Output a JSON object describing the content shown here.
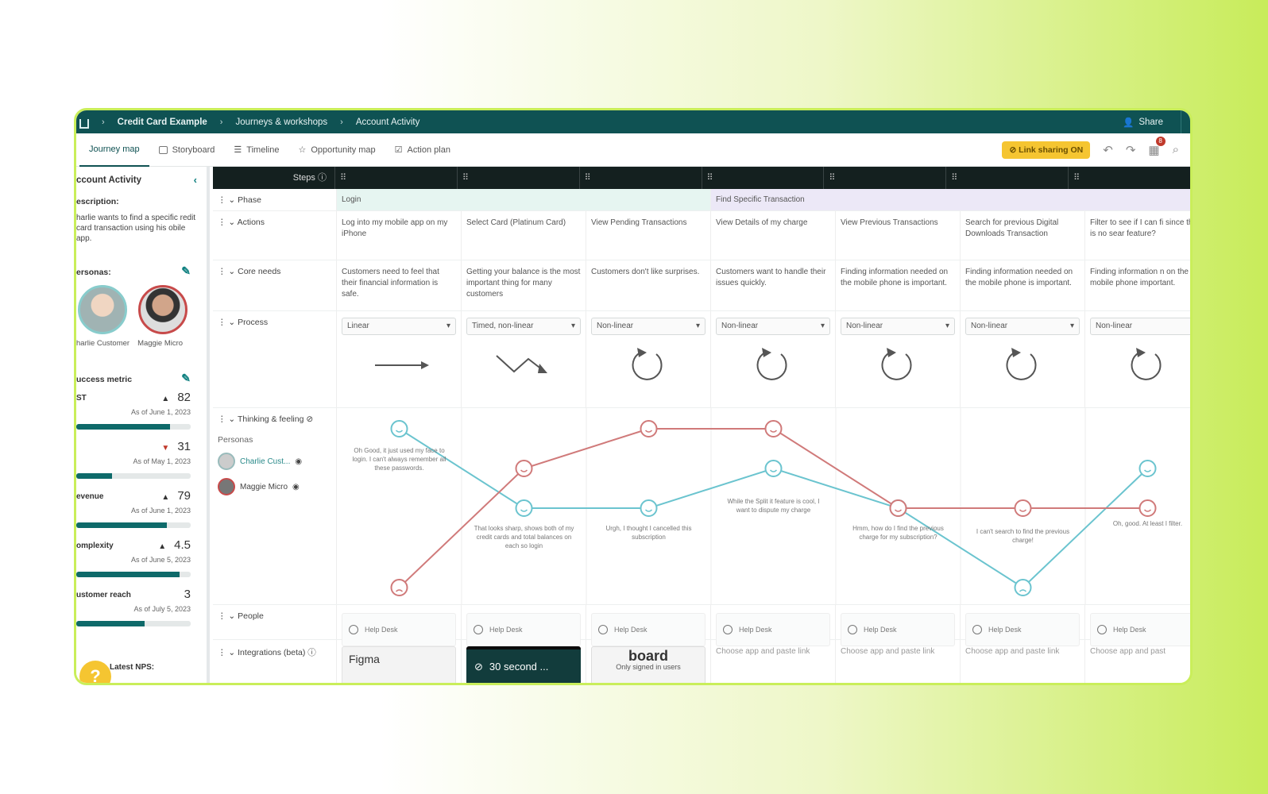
{
  "breadcrumb": [
    "Credit Card Example",
    "Journeys & workshops",
    "Account Activity"
  ],
  "topbar": {
    "share": "Share"
  },
  "tabs": [
    "Journey map",
    "Storyboard",
    "Timeline",
    "Opportunity map",
    "Action plan"
  ],
  "toolbar": {
    "link_sharing": "Link sharing ON",
    "notifications": "8"
  },
  "left": {
    "title": "ccount Activity",
    "description_label": "escription:",
    "description": "harlie wants to find a specific redit card transaction using his obile app.",
    "personas_label": "ersonas:",
    "personas": [
      "harlie Customer",
      "Maggie Micro"
    ],
    "metrics_label": "uccess metric",
    "metrics": [
      {
        "name": "ST",
        "arrow": "▲",
        "value": "82",
        "asof": "As of June 1, 2023",
        "progress": 0.82
      },
      {
        "name": "",
        "arrow": "▼",
        "value": "31",
        "asof": "As of May 1, 2023",
        "progress": 0.31
      },
      {
        "name": "evenue",
        "arrow": "▲",
        "value": "79",
        "asof": "As of June 1, 2023",
        "progress": 0.79
      },
      {
        "name": "omplexity",
        "arrow": "▲",
        "value": "4.5",
        "asof": "As of June 5, 2023",
        "progress": 0.9
      },
      {
        "name": "ustomer reach",
        "arrow": "",
        "value": "3",
        "asof": "As of July 5, 2023",
        "progress": 0.6
      }
    ],
    "latest_nps": "Latest NPS:"
  },
  "grid": {
    "steps_label": "Steps",
    "row_labels": {
      "phase": "Phase",
      "actions": "Actions",
      "core_needs": "Core needs",
      "process": "Process",
      "thinking": "Thinking & feeling",
      "personas": "Personas",
      "people": "People",
      "integrations": "Integrations (beta)"
    },
    "phases": [
      "Login",
      "Find Specific Transaction"
    ],
    "actions": [
      "Log into my mobile app on my iPhone",
      "Select Card (Platinum Card)",
      "View Pending Transactions",
      "View Details of my charge",
      "View Previous Transactions",
      "Search for previous Digital Downloads Transaction",
      "Filter to see if I can fi since there is no sear feature?"
    ],
    "core_needs": [
      "Customers need to feel that their financial information is safe.",
      "Getting your balance is the most important thing for many customers",
      "Customers don't like surprises.",
      "Customers want to handle their issues quickly.",
      "Finding information needed on the mobile phone is important.",
      "Finding information needed on the mobile phone is important.",
      "Finding information n on the mobile phone important."
    ],
    "process": [
      "Linear",
      "Timed, non-linear",
      "Non-linear",
      "Non-linear",
      "Non-linear",
      "Non-linear",
      "Non-linear"
    ],
    "tf_personas": [
      "Charlie Cust...",
      "Maggie Micro"
    ],
    "tf_notes": [
      "Oh Good, it just used my face to login. I can't always remember all these passwords.",
      "That looks sharp, shows both of my credit cards and total balances on each so login",
      "Urgh, I thought I cancelled this subscription",
      "While the Split it feature is cool, I want to dispute my charge",
      "Hmm, how do I find the previous charge for my subscription?",
      "I can't search to find the previous charge!",
      "Oh, good. At least I filter."
    ],
    "people": [
      "Help Desk",
      "Help Desk",
      "Help Desk",
      "Help Desk",
      "Help Desk",
      "Help Desk",
      "Help Desk"
    ],
    "integrations": [
      "Figma",
      "30 second ...",
      "board",
      "Choose app and paste link",
      "Choose app and paste link",
      "Choose app and paste link",
      "Choose app and past"
    ],
    "board_sub": "Only signed in users"
  },
  "chart_data": {
    "type": "line",
    "categories": [
      "1",
      "2",
      "3",
      "4",
      "5",
      "6",
      "7"
    ],
    "series": [
      {
        "name": "Charlie Cust...",
        "values": [
          4,
          2,
          2,
          3,
          2,
          0,
          3
        ],
        "color": "#6bc4cf"
      },
      {
        "name": "Maggie Micro",
        "values": [
          0,
          3,
          4,
          4,
          2,
          2,
          2
        ],
        "color": "#d07a7a"
      }
    ],
    "ylim": [
      0,
      4
    ]
  }
}
